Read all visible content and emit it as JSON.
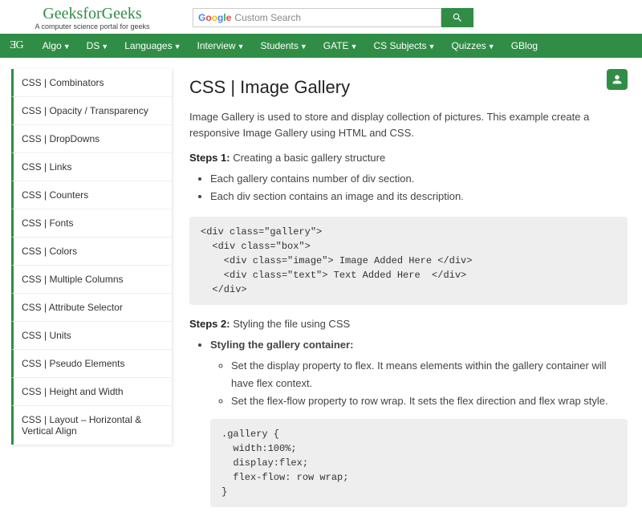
{
  "header": {
    "logo": "GeeksforGeeks",
    "tagline": "A computer science portal for geeks",
    "search_placeholder": "Custom Search"
  },
  "nav": {
    "brand": "ƎG",
    "items": [
      "Algo",
      "DS",
      "Languages",
      "Interview",
      "Students",
      "GATE",
      "CS Subjects",
      "Quizzes",
      "GBlog"
    ]
  },
  "sidebar": {
    "items": [
      "CSS | Combinators",
      "CSS | Opacity / Transparency",
      "CSS | DropDowns",
      "CSS | Links",
      "CSS | Counters",
      "CSS | Fonts",
      "CSS | Colors",
      "CSS | Multiple Columns",
      "CSS | Attribute Selector",
      "CSS | Units",
      "CSS | Pseudo Elements",
      "CSS | Height and Width",
      "CSS | Layout – Horizontal & Vertical Align"
    ]
  },
  "article": {
    "title": "CSS | Image Gallery",
    "intro": "Image Gallery is used to store and display collection of pictures. This example create a responsive Image Gallery using HTML and CSS.",
    "step1_label": "Steps 1:",
    "step1_text": " Creating a basic gallery structure",
    "step1_bullets": [
      "Each gallery contains number of div section.",
      "Each div section contains an image and its description."
    ],
    "code1": "<div class=\"gallery\">\n  <div class=\"box\">\n    <div class=\"image\"> Image Added Here </div>\n    <div class=\"text\"> Text Added Here  </div>\n  </div>",
    "step2_label": "Steps 2:",
    "step2_text": " Styling the file using CSS",
    "styling_head": "Styling the gallery container:",
    "step2_bullets": [
      "Set the display property to flex. It means elements within the gallery container will have flex context.",
      "Set the flex-flow property to row wrap. It sets the flex direction and flex wrap style."
    ],
    "code2": ".gallery {\n  width:100%;\n  display:flex;\n  flex-flow: row wrap;\n}"
  }
}
